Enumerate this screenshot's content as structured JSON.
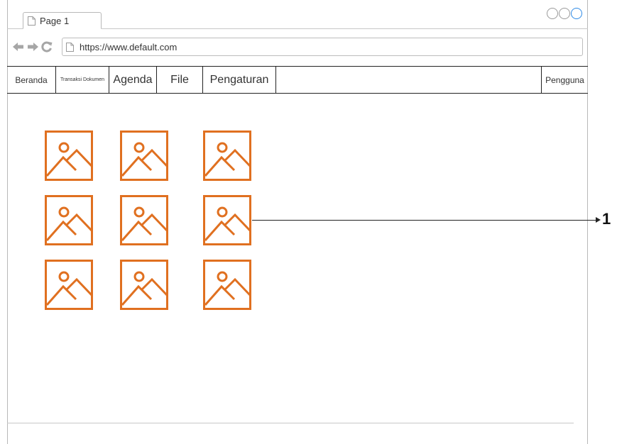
{
  "window": {
    "tab_title": "Page 1",
    "url": "https://www.default.com"
  },
  "menu": {
    "items": [
      {
        "label": "Beranda"
      },
      {
        "label": "Transaksi Dokumen"
      },
      {
        "label": "Agenda"
      },
      {
        "label": "File"
      },
      {
        "label": "Pengaturan"
      }
    ],
    "user_label": "Pengguna"
  },
  "gallery": {
    "item_icon": "image-icon",
    "icon_color": "#e07020",
    "rows": 3,
    "columns": 3
  },
  "annotation": {
    "label": "1"
  }
}
